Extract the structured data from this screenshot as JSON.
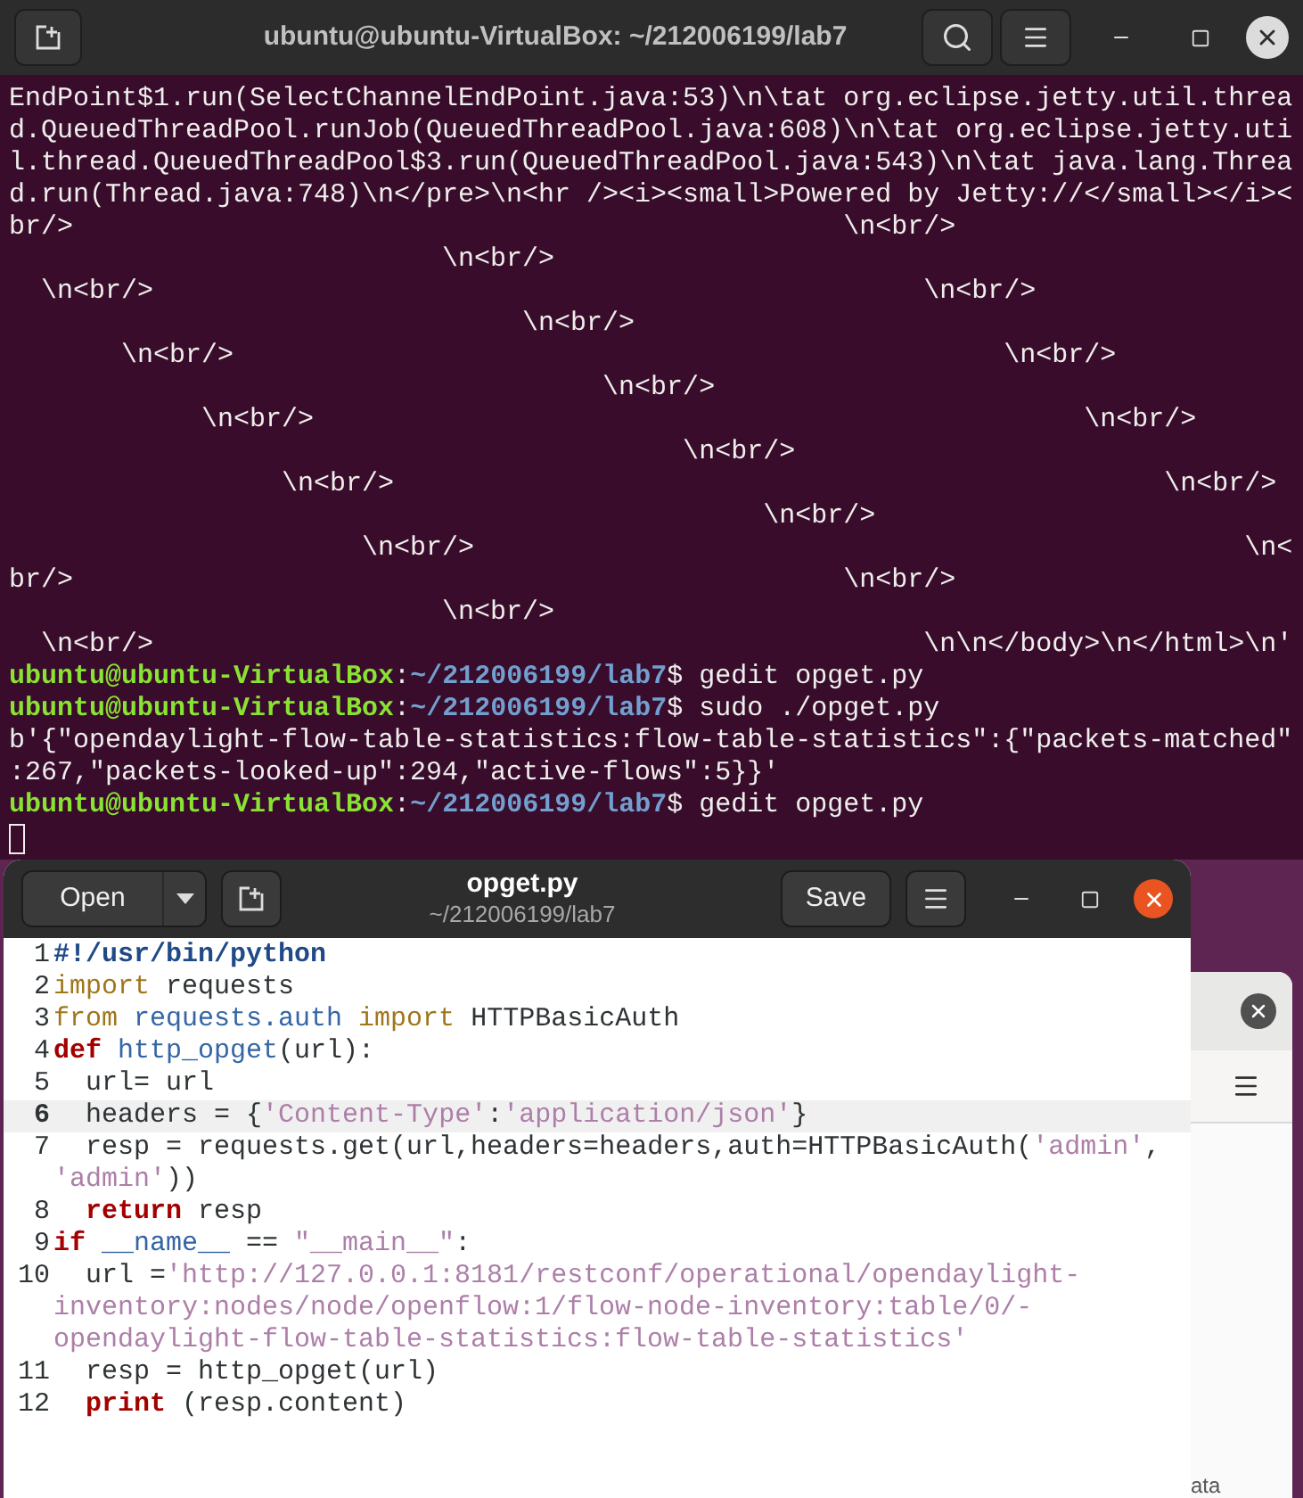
{
  "terminal": {
    "title": "ubuntu@ubuntu-VirtualBox: ~/212006199/lab7",
    "lines": [
      {
        "kind": "output",
        "text": "EndPoint$1.run(SelectChannelEndPoint.java:53)\\n\\tat org.eclipse.jetty.util.threa"
      },
      {
        "kind": "output",
        "text": "d.QueuedThreadPool.runJob(QueuedThreadPool.java:608)\\n\\tat org.eclipse.jetty.uti"
      },
      {
        "kind": "output",
        "text": "l.thread.QueuedThreadPool$3.run(QueuedThreadPool.java:543)\\n\\tat java.lang.Threa"
      },
      {
        "kind": "output",
        "text": "d.run(Thread.java:748)\\n</pre>\\n<hr /><i><small>Powered by Jetty://</small></i><"
      },
      {
        "kind": "output",
        "text": "br/>                                                \\n<br/>"
      },
      {
        "kind": "output",
        "text": "                           \\n<br/>"
      },
      {
        "kind": "output",
        "text": "  \\n<br/>                                                \\n<br/>"
      },
      {
        "kind": "output",
        "text": "                                \\n<br/>"
      },
      {
        "kind": "output",
        "text": "       \\n<br/>                                                \\n<br/>"
      },
      {
        "kind": "output",
        "text": "                                     \\n<br/>"
      },
      {
        "kind": "output",
        "text": "            \\n<br/>                                                \\n<br/>"
      },
      {
        "kind": "output",
        "text": "                                          \\n<br/>"
      },
      {
        "kind": "output",
        "text": "                 \\n<br/>                                                \\n<br/>"
      },
      {
        "kind": "output",
        "text": "                                               \\n<br/>"
      },
      {
        "kind": "output",
        "text": "                      \\n<br/>                                                \\n<"
      },
      {
        "kind": "output",
        "text": "br/>                                                \\n<br/>"
      },
      {
        "kind": "output",
        "text": "                           \\n<br/>"
      },
      {
        "kind": "output",
        "text": "  \\n<br/>                                                \\n\\n</body>\\n</html>\\n'"
      },
      {
        "kind": "prompt",
        "user": "ubuntu@ubuntu-VirtualBox",
        "sep": ":",
        "path": "~/212006199/lab7",
        "command": "$ gedit opget.py"
      },
      {
        "kind": "prompt",
        "user": "ubuntu@ubuntu-VirtualBox",
        "sep": ":",
        "path": "~/212006199/lab7",
        "command": "$ sudo ./opget.py"
      },
      {
        "kind": "output",
        "text": "b'{\"opendaylight-flow-table-statistics:flow-table-statistics\":{\"packets-matched\""
      },
      {
        "kind": "output",
        "text": ":267,\"packets-looked-up\":294,\"active-flows\":5}}'"
      },
      {
        "kind": "prompt",
        "user": "ubuntu@ubuntu-VirtualBox",
        "sep": ":",
        "path": "~/212006199/lab7",
        "command": "$ gedit opget.py"
      },
      {
        "kind": "cursor"
      }
    ]
  },
  "editor": {
    "open_button": "Open",
    "title": "opget.py",
    "subtitle": "~/212006199/lab7",
    "save_button": "Save",
    "lines": [
      {
        "number": "1",
        "current": false,
        "tokens": [
          {
            "kind": "shebang",
            "text": "#!/usr/bin/python"
          }
        ]
      },
      {
        "number": "2",
        "current": false,
        "tokens": [
          {
            "kind": "import",
            "text": "import"
          },
          {
            "kind": "plain",
            "text": " requests"
          }
        ]
      },
      {
        "number": "3",
        "current": false,
        "tokens": [
          {
            "kind": "import",
            "text": "from "
          },
          {
            "kind": "name",
            "text": "requests.auth"
          },
          {
            "kind": "import",
            "text": " import"
          },
          {
            "kind": "plain",
            "text": " HTTPBasicAuth"
          }
        ]
      },
      {
        "number": "4",
        "current": false,
        "tokens": [
          {
            "kind": "keyword",
            "text": "def "
          },
          {
            "kind": "name",
            "text": "http_opget"
          },
          {
            "kind": "plain",
            "text": "(url):"
          }
        ]
      },
      {
        "number": "5",
        "current": false,
        "tokens": [
          {
            "kind": "plain",
            "text": "  url= url"
          }
        ]
      },
      {
        "number": "6",
        "current": true,
        "tokens": [
          {
            "kind": "plain",
            "text": "  headers = {"
          },
          {
            "kind": "string",
            "text": "'Content-Type'"
          },
          {
            "kind": "plain",
            "text": ":"
          },
          {
            "kind": "string",
            "text": "'application/json'"
          },
          {
            "kind": "plain",
            "text": "}"
          }
        ]
      },
      {
        "number": "7",
        "current": false,
        "tokens": [
          {
            "kind": "plain",
            "text": "  resp = requests.get(url,headers=headers,auth=HTTPBasicAuth("
          },
          {
            "kind": "string",
            "text": "'admin'"
          },
          {
            "kind": "plain",
            "text": ", "
          },
          {
            "kind": "string",
            "text": "'admin'"
          },
          {
            "kind": "plain",
            "text": "))"
          }
        ]
      },
      {
        "number": "8",
        "current": false,
        "tokens": [
          {
            "kind": "keyword",
            "text": "  return"
          },
          {
            "kind": "plain",
            "text": " resp"
          }
        ]
      },
      {
        "number": "9",
        "current": false,
        "tokens": [
          {
            "kind": "keyword",
            "text": "if "
          },
          {
            "kind": "name",
            "text": "__name__"
          },
          {
            "kind": "plain",
            "text": " == "
          },
          {
            "kind": "string",
            "text": "\"__main__\""
          },
          {
            "kind": "plain",
            "text": ":"
          }
        ]
      },
      {
        "number": "10",
        "current": false,
        "tokens": [
          {
            "kind": "plain",
            "text": "  url ="
          },
          {
            "kind": "string",
            "text": "'http://127.0.0.1:8181/restconf/operational/opendaylight-inventory:nodes/node/openflow:1/flow-node-inventory:table/0/-opendaylight-flow-table-statistics:flow-table-statistics'"
          }
        ]
      },
      {
        "number": "11",
        "current": false,
        "tokens": [
          {
            "kind": "plain",
            "text": "  resp = http_opget(url)"
          }
        ]
      },
      {
        "number": "12",
        "current": false,
        "tokens": [
          {
            "kind": "keyword",
            "text": "  print"
          },
          {
            "kind": "plain",
            "text": " (resp.content)"
          }
        ]
      }
    ]
  },
  "background_window": {
    "text": "ata"
  }
}
